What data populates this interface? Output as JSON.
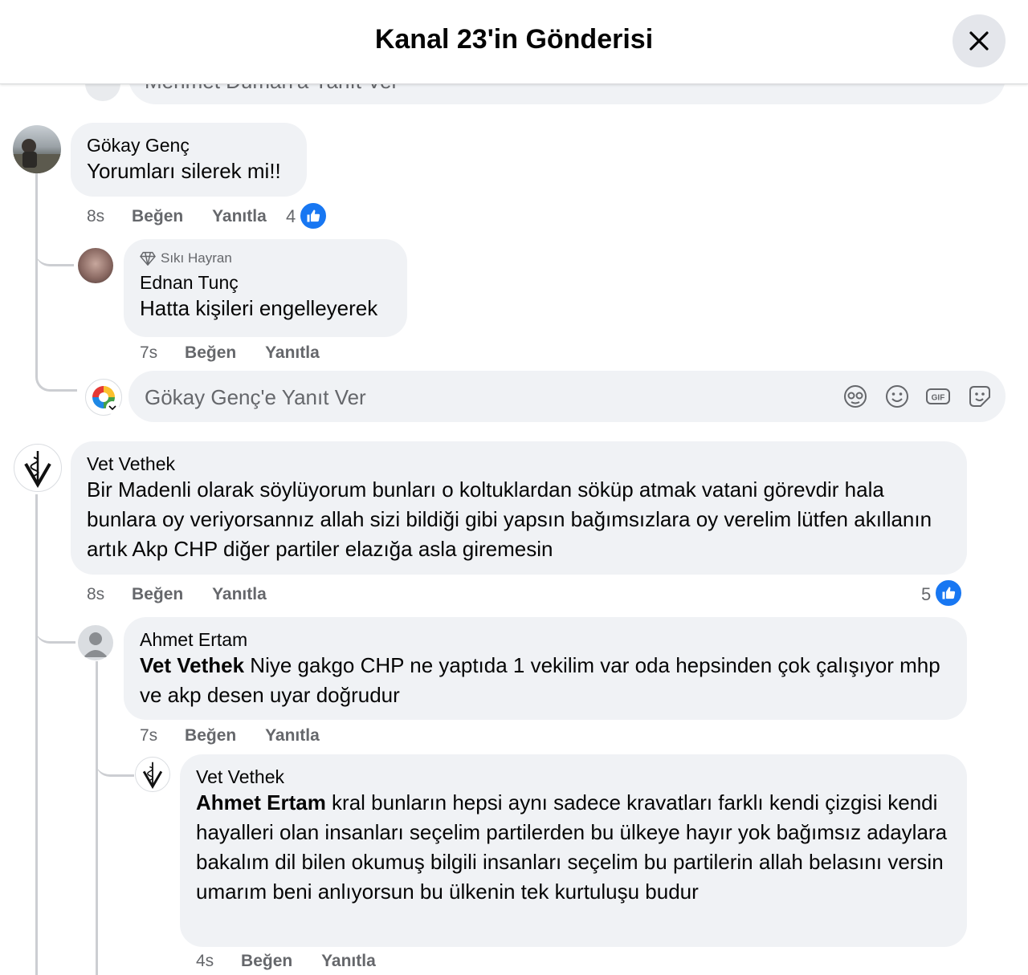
{
  "header": {
    "title": "Kanal 23'in Gönderisi"
  },
  "top_input": {
    "placeholder": "Mehmet Duman'a Yanıt Ver"
  },
  "comments": [
    {
      "author": "Gökay Genç",
      "text": "Yorumları silerek mi!!",
      "time": "8s",
      "like_label": "Beğen",
      "reply_label": "Yanıtla",
      "reactions": "4"
    },
    {
      "badge": "Sıkı Hayran",
      "author": "Ednan Tunç",
      "text": "Hatta kişileri engelleyerek",
      "time": "7s",
      "like_label": "Beğen",
      "reply_label": "Yanıtla"
    },
    {
      "author": "Vet Vethek",
      "text": "Bir Madenli olarak söylüyorum bunları o koltuklardan söküp atmak vatani görevdir hala bunlara oy veriyorsannız allah sizi bildiği gibi yapsın bağımsızlara oy verelim lütfen akıllanın artık Akp CHP diğer partiler elazığa asla giremesin",
      "time": "8s",
      "like_label": "Beğen",
      "reply_label": "Yanıtla",
      "reactions": "5"
    },
    {
      "author": "Ahmet Ertam",
      "mention": "Vet Vethek",
      "text": " Niye gakgo CHP ne yaptıda 1 vekilim var oda hepsinden çok çalışıyor mhp ve akp desen uyar doğrudur",
      "time": "7s",
      "like_label": "Beğen",
      "reply_label": "Yanıtla"
    },
    {
      "author": "Vet Vethek",
      "mention": "Ahmet Ertam",
      "text": " kral bunların hepsi aynı sadece kravatları farklı kendi çizgisi kendi hayalleri olan insanları seçelim partilerden bu ülkeye hayır yok bağımsız adaylara bakalım dil bilen okumuş bilgili insanları seçelim bu partilerin allah belasını versin umarım beni anlıyorsun bu ülkenin tek kurtuluşu budur",
      "time": "4s",
      "like_label": "Beğen",
      "reply_label": "Yanıtla"
    }
  ],
  "reply_input": {
    "placeholder": "Gökay Genç'e Yanıt Ver"
  },
  "icons": {
    "close": "close-icon",
    "avatar_sticker": "avatar-sticker-icon",
    "emoji": "emoji-icon",
    "gif": "gif-icon",
    "sticker": "sticker-icon",
    "like": "thumbs-up-icon",
    "fan_badge": "diamond-icon"
  },
  "colors": {
    "accent": "#1877f2",
    "bubble": "#f0f2f5",
    "muted": "#65676b"
  }
}
